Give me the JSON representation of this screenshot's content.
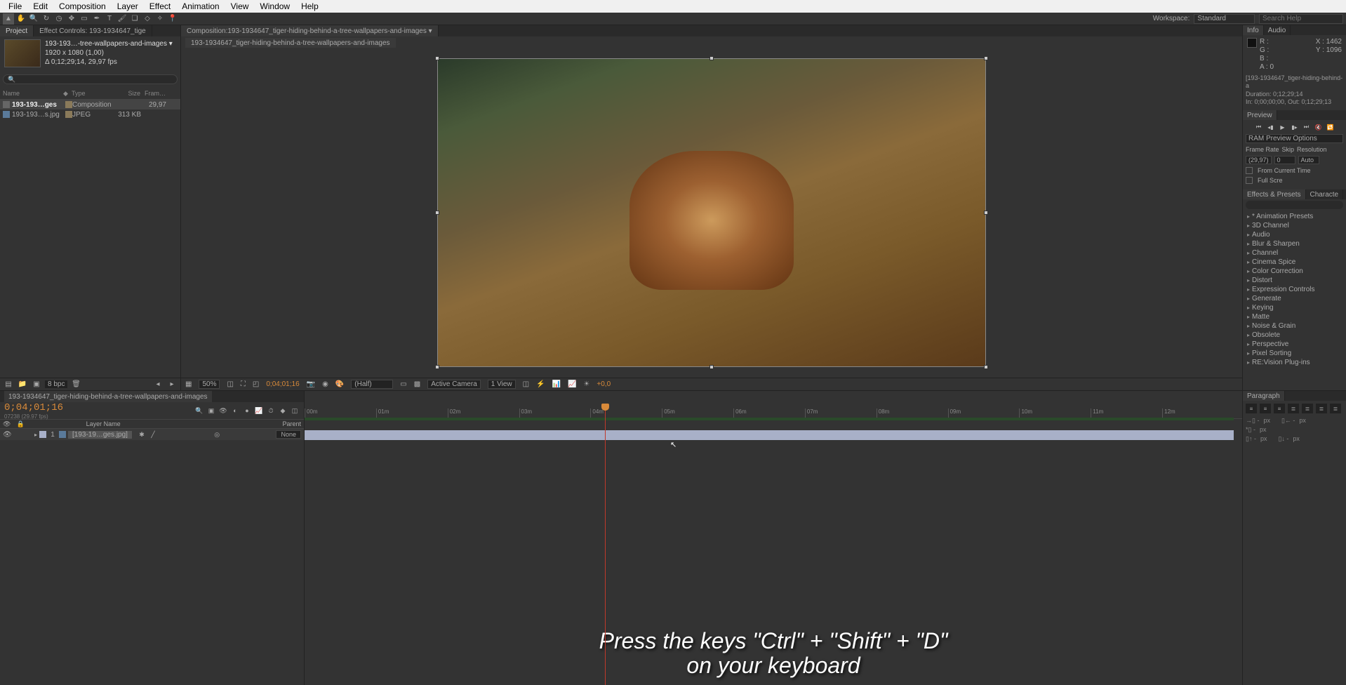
{
  "menu": [
    "File",
    "Edit",
    "Composition",
    "Layer",
    "Effect",
    "Animation",
    "View",
    "Window",
    "Help"
  ],
  "toolbar": {
    "workspace_label": "Workspace:",
    "workspace_value": "Standard",
    "search_placeholder": "Search Help"
  },
  "project": {
    "tab_project": "Project",
    "tab_ec": "Effect Controls: 193-1934647_tige",
    "comp_name": "193-193…-tree-wallpapers-and-images ▾",
    "dims": "1920 x 1080 (1,00)",
    "dur": "Δ 0;12;29;14, 29,97 fps",
    "cols": {
      "name": "Name",
      "type": "Type",
      "size": "Size",
      "fr": "Fram…"
    },
    "rows": [
      {
        "name": "193-193…ges",
        "type": "Composition",
        "size": "",
        "fr": "29,97",
        "sel": true
      },
      {
        "name": "193-193…s.jpg",
        "type": "JPEG",
        "size": "313 KB",
        "fr": "",
        "sel": false
      }
    ],
    "bpc": "8 bpc"
  },
  "composition": {
    "tab_prefix": "Composition: ",
    "tab_name": "193-1934647_tiger-hiding-behind-a-tree-wallpapers-and-images ▾",
    "subtab": "193-1934647_tiger-hiding-behind-a-tree-wallpapers-and-images",
    "footer": {
      "zoom": "50%",
      "timecode": "0;04;01;16",
      "res": "(Half)",
      "camera": "Active Camera",
      "view": "1 View",
      "exp": "+0,0"
    }
  },
  "info": {
    "tab_info": "Info",
    "tab_audio": "Audio",
    "R": "R :",
    "G": "G :",
    "B": "B :",
    "A": "A :  0",
    "X": "X : 1462",
    "Y": "Y : 1096",
    "name_line": "[193-1934647_tiger-hiding-behind-a",
    "dur_line": "Duration: 0;12;29;14",
    "inout_line": "In: 0;00;00;00, Out: 0;12;29;13"
  },
  "preview": {
    "tab": "Preview",
    "ram_label": "RAM Preview Options",
    "fr_label": "Frame Rate",
    "skip_label": "Skip",
    "res_label": "Resolution",
    "fr": "(29,97)",
    "skip": "0",
    "res": "Auto",
    "from_current": "From Current Time",
    "full_screen": "Full Scre"
  },
  "effects": {
    "tab_effects": "Effects & Presets",
    "tab_char": "Characte",
    "items": [
      "* Animation Presets",
      "3D Channel",
      "Audio",
      "Blur & Sharpen",
      "Channel",
      "Cinema Spice",
      "Color Correction",
      "Distort",
      "Expression Controls",
      "Generate",
      "Keying",
      "Matte",
      "Noise & Grain",
      "Obsolete",
      "Perspective",
      "Pixel Sorting",
      "RE:Vision Plug-ins"
    ]
  },
  "timeline": {
    "tab": "193-1934647_tiger-hiding-behind-a-tree-wallpapers-and-images",
    "timecode": "0;04;01;16",
    "frames": "07238 (29.97 fps)",
    "head_name": "Layer Name",
    "head_parent": "Parent",
    "layer": {
      "n": "1",
      "name": "[193-19…ges.jpg]",
      "mode": "None"
    },
    "ticks": [
      "00m",
      "01m",
      "02m",
      "03m",
      "04m",
      "05m",
      "06m",
      "07m",
      "08m",
      "09m",
      "10m",
      "11m",
      "12m"
    ]
  },
  "paragraph": {
    "tab": "Paragraph",
    "px": "px"
  },
  "caption": "Press the keys \"Ctrl\" + \"Shift\" + \"D\"\non your keyboard"
}
